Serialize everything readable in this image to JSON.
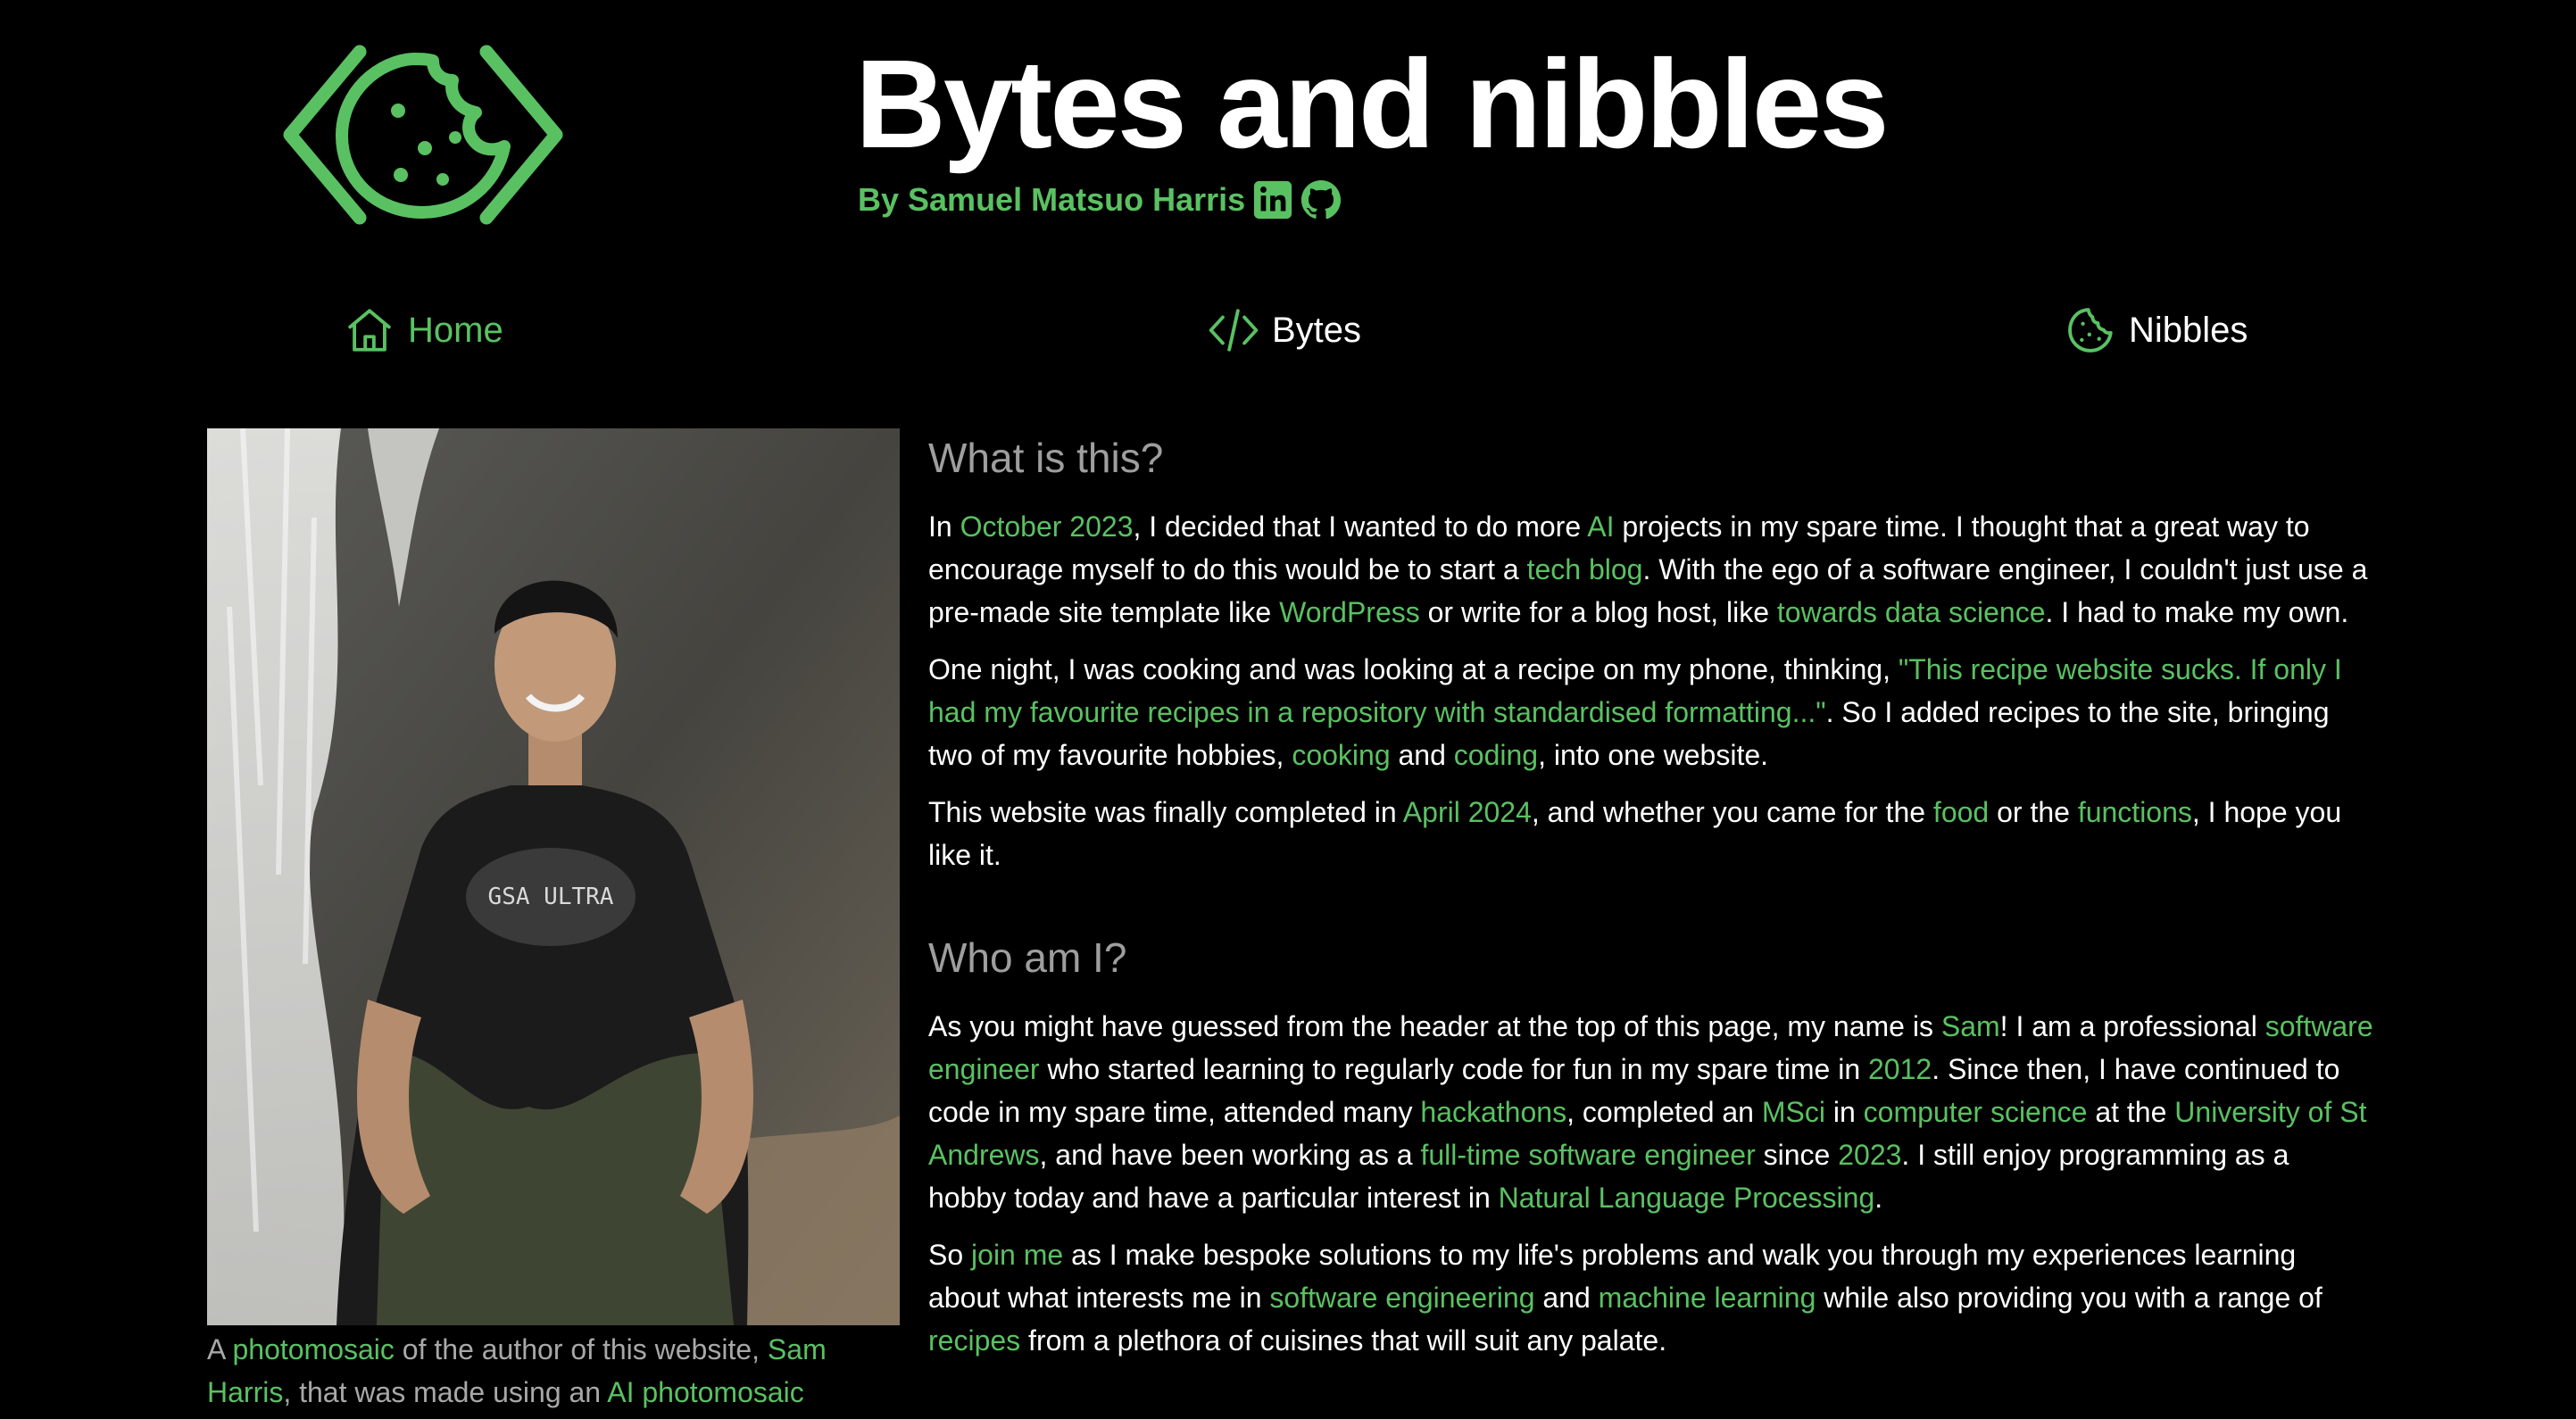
{
  "header": {
    "title": "Bytes and nibbles",
    "byline": "By Samuel Matsuo Harris",
    "social_icons": [
      "linkedin-icon",
      "github-icon"
    ],
    "logo_icon": "cookie-code-brackets-logo"
  },
  "nav": {
    "home": "Home",
    "bytes": "Bytes",
    "nibbles": "Nibbles"
  },
  "photo": {
    "shirt_text": "GSA ULTRA",
    "caption": [
      {
        "t": "A "
      },
      {
        "t": "photomosaic",
        "link": true
      },
      {
        "t": " of the author of this website, "
      },
      {
        "t": "Sam Harris",
        "link": true
      },
      {
        "t": ", that was made using an "
      },
      {
        "t": "AI photomosaic",
        "link": true
      }
    ]
  },
  "sections": [
    {
      "heading": "What is this?",
      "paragraphs": [
        [
          {
            "t": "In "
          },
          {
            "t": "October 2023",
            "link": true
          },
          {
            "t": ", I decided that I wanted to do more "
          },
          {
            "t": "AI",
            "link": true
          },
          {
            "t": " projects in my spare time. I thought that a great way to encourage myself to do this would be to start a "
          },
          {
            "t": "tech blog",
            "link": true
          },
          {
            "t": ". With the ego of a software engineer, I couldn't just use a pre-made site template like "
          },
          {
            "t": "WordPress",
            "link": true
          },
          {
            "t": " or write for a blog host, like "
          },
          {
            "t": "towards data science",
            "link": true
          },
          {
            "t": ". I had to make my own."
          }
        ],
        [
          {
            "t": "One night, I was cooking and was looking at a recipe on my phone, thinking, "
          },
          {
            "t": "\"This recipe website sucks. If only I had my favourite recipes in a repository with standardised formatting...\"",
            "link": true
          },
          {
            "t": ". So I added recipes to the site, bringing two of my favourite hobbies, "
          },
          {
            "t": "cooking",
            "link": true
          },
          {
            "t": " and "
          },
          {
            "t": "coding",
            "link": true
          },
          {
            "t": ", into one website."
          }
        ],
        [
          {
            "t": "This website was finally completed in "
          },
          {
            "t": "April 2024",
            "link": true
          },
          {
            "t": ", and whether you came for the "
          },
          {
            "t": "food",
            "link": true
          },
          {
            "t": " or the "
          },
          {
            "t": "functions",
            "link": true
          },
          {
            "t": ", I hope you like it."
          }
        ]
      ]
    },
    {
      "heading": "Who am I?",
      "paragraphs": [
        [
          {
            "t": "As you might have guessed from the header at the top of this page, my name is "
          },
          {
            "t": "Sam",
            "link": true
          },
          {
            "t": "! I am a professional "
          },
          {
            "t": "software engineer",
            "link": true
          },
          {
            "t": " who started learning to regularly code for fun in my spare time in "
          },
          {
            "t": "2012",
            "link": true
          },
          {
            "t": ". Since then, I have continued to code in my spare time, attended many "
          },
          {
            "t": "hackathons",
            "link": true
          },
          {
            "t": ", completed an "
          },
          {
            "t": "MSci",
            "link": true
          },
          {
            "t": " in "
          },
          {
            "t": "computer science",
            "link": true
          },
          {
            "t": " at the "
          },
          {
            "t": "University of St Andrews",
            "link": true
          },
          {
            "t": ", and have been working as a "
          },
          {
            "t": "full-time software engineer",
            "link": true
          },
          {
            "t": " since "
          },
          {
            "t": "2023",
            "link": true
          },
          {
            "t": ". I still enjoy programming as a hobby today and have a particular interest in "
          },
          {
            "t": "Natural Language Processing",
            "link": true
          },
          {
            "t": "."
          }
        ],
        [
          {
            "t": "So "
          },
          {
            "t": "join me",
            "link": true
          },
          {
            "t": " as I make bespoke solutions to my life's problems and walk you through my experiences learning about what interests me in "
          },
          {
            "t": "software engineering",
            "link": true
          },
          {
            "t": " and "
          },
          {
            "t": "machine learning",
            "link": true
          },
          {
            "t": " while also providing you with a range of "
          },
          {
            "t": "recipes",
            "link": true
          },
          {
            "t": " from a plethora of cuisines that will suit any palate."
          }
        ]
      ]
    }
  ],
  "colors": {
    "accent": "#5ac162",
    "background": "#000000",
    "text": "#ffffff",
    "heading": "#9e9e9e",
    "caption": "#a8a8a8"
  }
}
